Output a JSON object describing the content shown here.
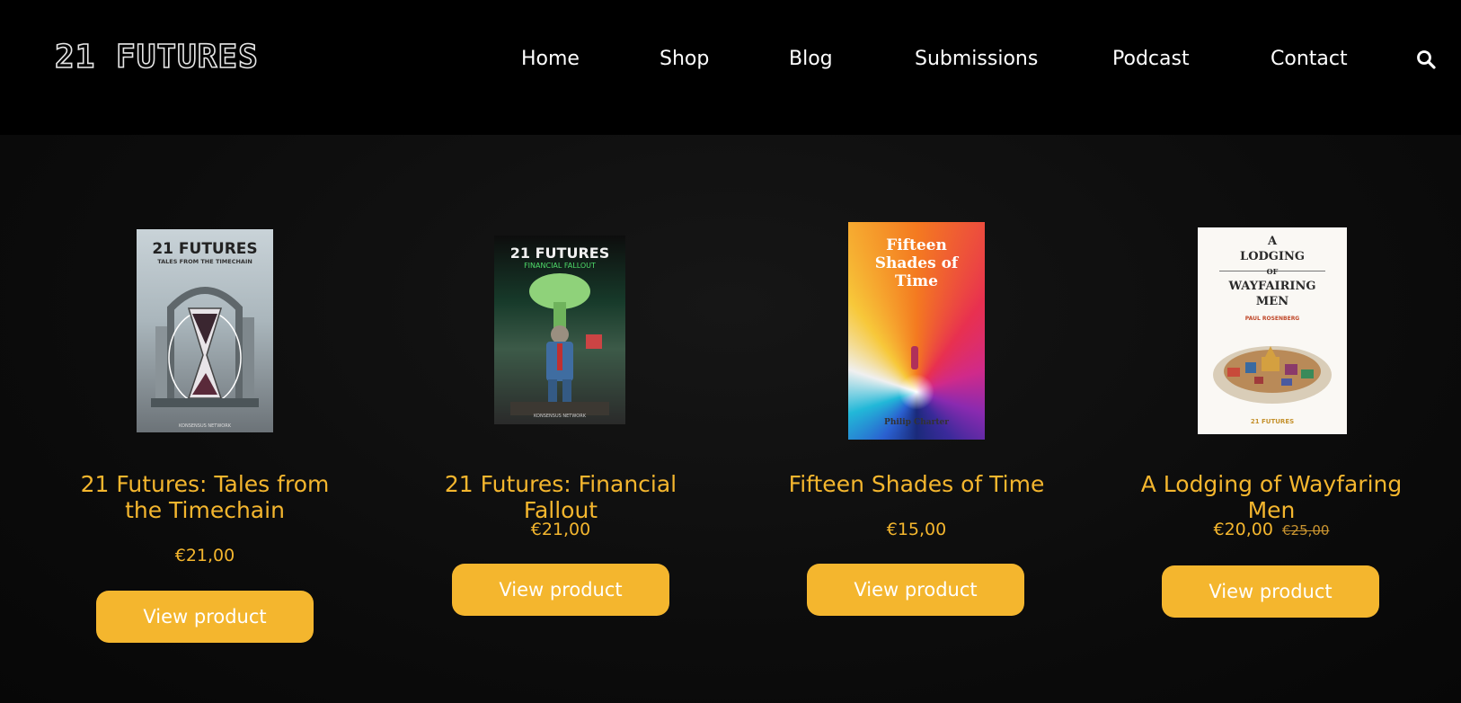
{
  "header": {
    "logo": "21 FUTURES",
    "nav": [
      {
        "label": "Home"
      },
      {
        "label": "Shop"
      },
      {
        "label": "Blog"
      },
      {
        "label": "Submissions"
      },
      {
        "label": "Podcast"
      },
      {
        "label": "Contact"
      }
    ],
    "search_icon": "search-icon"
  },
  "colors": {
    "accent": "#f4b62e",
    "background": "#000000"
  },
  "products": [
    {
      "title": "21 Futures: Tales from the Timechain",
      "price": "€21,00",
      "button": "View product",
      "cover": {
        "title": "21 FUTURES",
        "subtitle": "TALES FROM THE TIMECHAIN",
        "publisher": "KONSENSUS NETWORK"
      }
    },
    {
      "title": "21 Futures: Financial Fallout",
      "price": "€21,00",
      "button": "View product",
      "cover": {
        "title": "21 FUTURES",
        "subtitle": "FINANCIAL FALLOUT",
        "publisher": "KONSENSUS NETWORK"
      }
    },
    {
      "title": "Fifteen Shades of Time",
      "price": "€15,00",
      "button": "View product",
      "cover": {
        "title": "Fifteen Shades of Time",
        "author": "Philip Charter"
      }
    },
    {
      "title": "A Lodging of Wayfaring Men",
      "price": "€20,00",
      "old_price": "€25,00",
      "button": "View product",
      "cover": {
        "line1": "A",
        "line2": "LODGING",
        "line3": "OF",
        "line4": "WAYFAIRING",
        "line5": "MEN",
        "author": "PAUL ROSENBERG",
        "imprint": "21 FUTURES"
      }
    }
  ]
}
